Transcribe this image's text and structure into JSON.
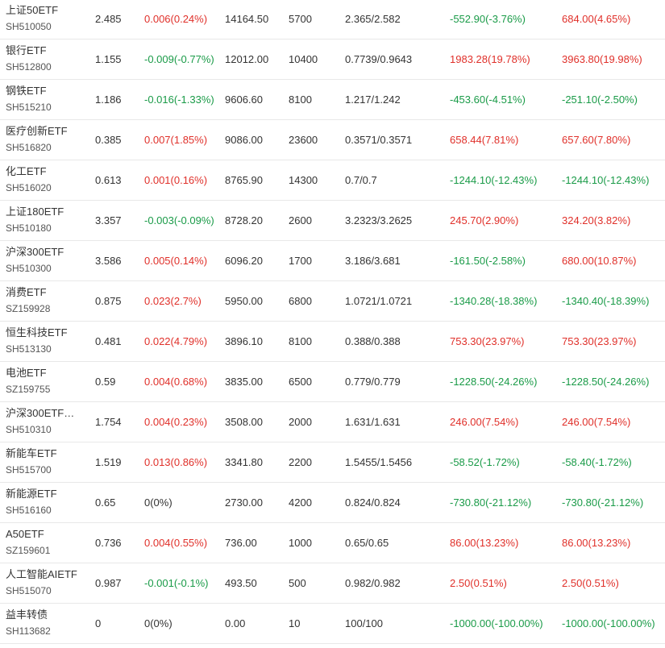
{
  "colors": {
    "up": "#e0302a",
    "down": "#1a9b48",
    "flat": "#333333"
  },
  "rows": [
    {
      "name": "上证50ETF",
      "code": "SH510050",
      "price": "2.485",
      "change": "0.006(0.24%)",
      "change_dir": "up",
      "value": "14164.50",
      "qty": "5700",
      "cost": "2.365/2.582",
      "pl1": "-552.90(-3.76%)",
      "pl1_dir": "down",
      "pl2": "684.00(4.65%)",
      "pl2_dir": "up"
    },
    {
      "name": "银行ETF",
      "code": "SH512800",
      "price": "1.155",
      "change": "-0.009(-0.77%)",
      "change_dir": "down",
      "value": "12012.00",
      "qty": "10400",
      "cost": "0.7739/0.9643",
      "pl1": "1983.28(19.78%)",
      "pl1_dir": "up",
      "pl2": "3963.80(19.98%)",
      "pl2_dir": "up"
    },
    {
      "name": "钢铁ETF",
      "code": "SH515210",
      "price": "1.186",
      "change": "-0.016(-1.33%)",
      "change_dir": "down",
      "value": "9606.60",
      "qty": "8100",
      "cost": "1.217/1.242",
      "pl1": "-453.60(-4.51%)",
      "pl1_dir": "down",
      "pl2": "-251.10(-2.50%)",
      "pl2_dir": "down"
    },
    {
      "name": "医疗创新ETF",
      "code": "SH516820",
      "price": "0.385",
      "change": "0.007(1.85%)",
      "change_dir": "up",
      "value": "9086.00",
      "qty": "23600",
      "cost": "0.3571/0.3571",
      "pl1": "658.44(7.81%)",
      "pl1_dir": "up",
      "pl2": "657.60(7.80%)",
      "pl2_dir": "up"
    },
    {
      "name": "化工ETF",
      "code": "SH516020",
      "price": "0.613",
      "change": "0.001(0.16%)",
      "change_dir": "up",
      "value": "8765.90",
      "qty": "14300",
      "cost": "0.7/0.7",
      "pl1": "-1244.10(-12.43%)",
      "pl1_dir": "down",
      "pl2": "-1244.10(-12.43%)",
      "pl2_dir": "down"
    },
    {
      "name": "上证180ETF",
      "code": "SH510180",
      "price": "3.357",
      "change": "-0.003(-0.09%)",
      "change_dir": "down",
      "value": "8728.20",
      "qty": "2600",
      "cost": "3.2323/3.2625",
      "pl1": "245.70(2.90%)",
      "pl1_dir": "up",
      "pl2": "324.20(3.82%)",
      "pl2_dir": "up"
    },
    {
      "name": "沪深300ETF",
      "code": "SH510300",
      "price": "3.586",
      "change": "0.005(0.14%)",
      "change_dir": "up",
      "value": "6096.20",
      "qty": "1700",
      "cost": "3.186/3.681",
      "pl1": "-161.50(-2.58%)",
      "pl1_dir": "down",
      "pl2": "680.00(10.87%)",
      "pl2_dir": "up"
    },
    {
      "name": "消费ETF",
      "code": "SZ159928",
      "price": "0.875",
      "change": "0.023(2.7%)",
      "change_dir": "up",
      "value": "5950.00",
      "qty": "6800",
      "cost": "1.0721/1.0721",
      "pl1": "-1340.28(-18.38%)",
      "pl1_dir": "down",
      "pl2": "-1340.40(-18.39%)",
      "pl2_dir": "down"
    },
    {
      "name": "恒生科技ETF",
      "code": "SH513130",
      "price": "0.481",
      "change": "0.022(4.79%)",
      "change_dir": "up",
      "value": "3896.10",
      "qty": "8100",
      "cost": "0.388/0.388",
      "pl1": "753.30(23.97%)",
      "pl1_dir": "up",
      "pl2": "753.30(23.97%)",
      "pl2_dir": "up"
    },
    {
      "name": "电池ETF",
      "code": "SZ159755",
      "price": "0.59",
      "change": "0.004(0.68%)",
      "change_dir": "up",
      "value": "3835.00",
      "qty": "6500",
      "cost": "0.779/0.779",
      "pl1": "-1228.50(-24.26%)",
      "pl1_dir": "down",
      "pl2": "-1228.50(-24.26%)",
      "pl2_dir": "down"
    },
    {
      "name": "沪深300ETF…",
      "code": "SH510310",
      "price": "1.754",
      "change": "0.004(0.23%)",
      "change_dir": "up",
      "value": "3508.00",
      "qty": "2000",
      "cost": "1.631/1.631",
      "pl1": "246.00(7.54%)",
      "pl1_dir": "up",
      "pl2": "246.00(7.54%)",
      "pl2_dir": "up"
    },
    {
      "name": "新能车ETF",
      "code": "SH515700",
      "price": "1.519",
      "change": "0.013(0.86%)",
      "change_dir": "up",
      "value": "3341.80",
      "qty": "2200",
      "cost": "1.5455/1.5456",
      "pl1": "-58.52(-1.72%)",
      "pl1_dir": "down",
      "pl2": "-58.40(-1.72%)",
      "pl2_dir": "down"
    },
    {
      "name": "新能源ETF",
      "code": "SH516160",
      "price": "0.65",
      "change": "0(0%)",
      "change_dir": "flat",
      "value": "2730.00",
      "qty": "4200",
      "cost": "0.824/0.824",
      "pl1": "-730.80(-21.12%)",
      "pl1_dir": "down",
      "pl2": "-730.80(-21.12%)",
      "pl2_dir": "down"
    },
    {
      "name": "A50ETF",
      "code": "SZ159601",
      "price": "0.736",
      "change": "0.004(0.55%)",
      "change_dir": "up",
      "value": "736.00",
      "qty": "1000",
      "cost": "0.65/0.65",
      "pl1": "86.00(13.23%)",
      "pl1_dir": "up",
      "pl2": "86.00(13.23%)",
      "pl2_dir": "up"
    },
    {
      "name": "人工智能AIETF",
      "code": "SH515070",
      "price": "0.987",
      "change": "-0.001(-0.1%)",
      "change_dir": "down",
      "value": "493.50",
      "qty": "500",
      "cost": "0.982/0.982",
      "pl1": "2.50(0.51%)",
      "pl1_dir": "up",
      "pl2": "2.50(0.51%)",
      "pl2_dir": "up"
    },
    {
      "name": "益丰转债",
      "code": "SH113682",
      "price": "0",
      "change": "0(0%)",
      "change_dir": "flat",
      "value": "0.00",
      "qty": "10",
      "cost": "100/100",
      "pl1": "-1000.00(-100.00%)",
      "pl1_dir": "down",
      "pl2": "-1000.00(-100.00%)",
      "pl2_dir": "down"
    }
  ]
}
